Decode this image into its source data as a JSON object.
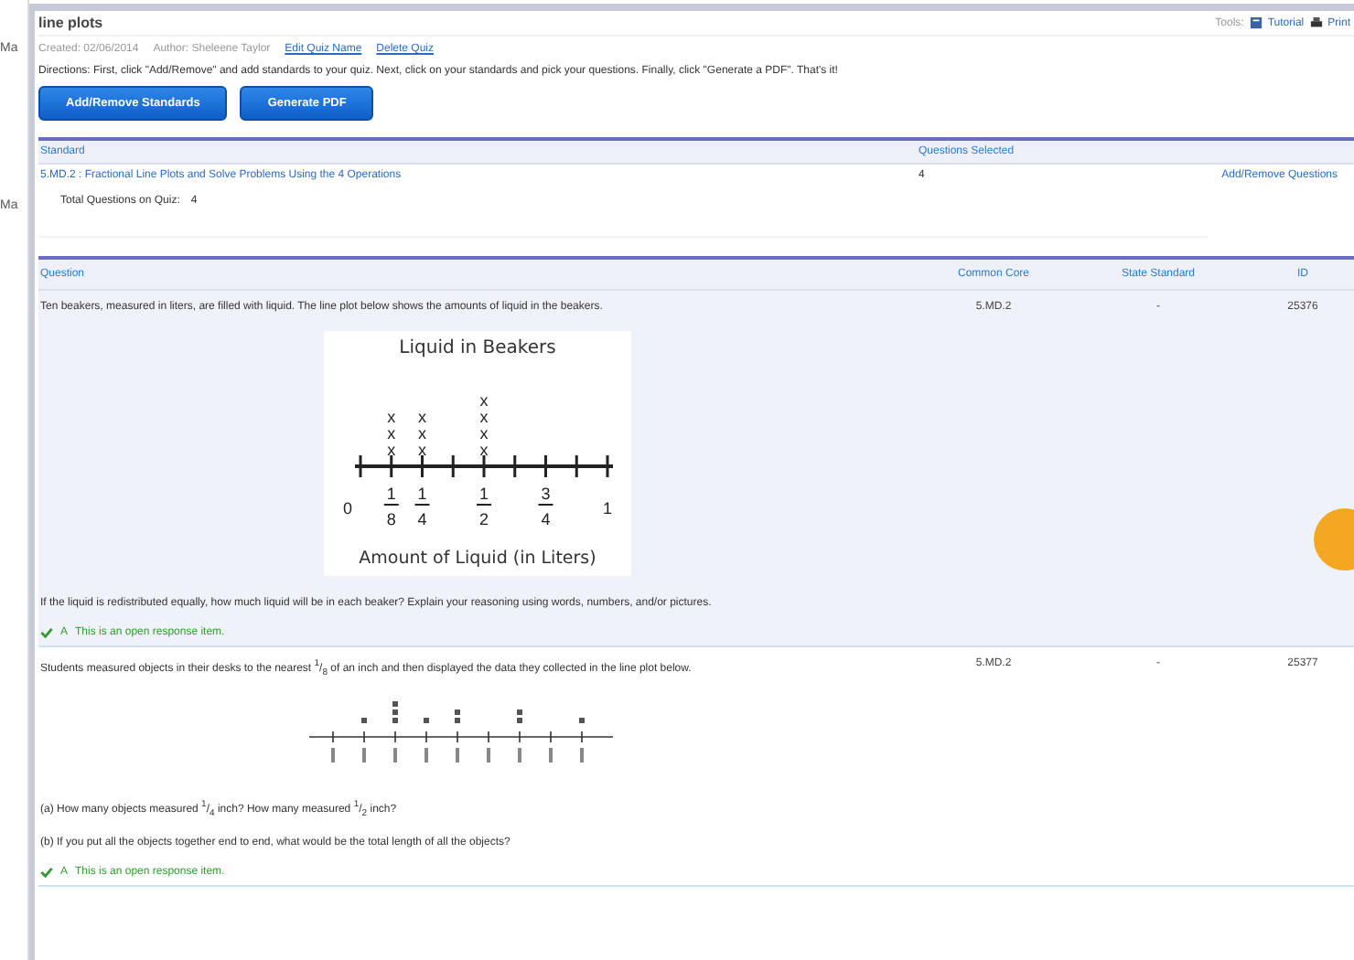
{
  "background": {
    "labels": [
      "Ma",
      "Ma"
    ]
  },
  "quiz": {
    "title": "line plots",
    "created": "Created: 02/06/2014",
    "author": "Author: Sheleene Taylor",
    "links": [
      "Edit Quiz Name",
      "Delete Quiz"
    ],
    "tools": {
      "label": "Tools:",
      "links": [
        "Tutorial",
        "Print"
      ]
    },
    "directions": "Directions: First, click \"Add/Remove\" and add standards to your quiz. Next, click on your standards and pick your questions. Finally, click \"Generate a PDF\". That's it!",
    "buttons": [
      "Add/Remove Standards",
      "Generate PDF"
    ]
  },
  "standards": {
    "columns": [
      "Standard",
      "Questions Selected"
    ],
    "rows": [
      {
        "standard": "5.MD.2 : Fractional Line Plots and Solve Problems Using the 4 Operations",
        "count": "4",
        "action": "Add/Remove Questions"
      }
    ],
    "total_label": "Total Questions on Quiz:",
    "total": "4"
  },
  "questions": {
    "columns": [
      "Question",
      "Common Core",
      "State Standard",
      "ID"
    ],
    "rows": [
      {
        "highlighted": true,
        "prompt": "Ten beakers, measured in liters, are filled with liquid. The line plot below shows the amounts of liquid in the beakers.",
        "common_core": "5.MD.2",
        "state_standard": "-",
        "id": "25376",
        "figure": {
          "kind": "plot",
          "title": "Liquid in Beakers",
          "xlabel": "Amount of Liquid (in Liters)",
          "ticks": [
            {
              "kind": "whole",
              "label": "0"
            },
            {
              "kind": "fraction",
              "numerator": "1",
              "denominator": "8",
              "marks": [
                "x",
                "x",
                "x"
              ]
            },
            {
              "kind": "fraction",
              "numerator": "1",
              "denominator": "4",
              "marks": [
                "x",
                "x",
                "x"
              ]
            },
            {
              "kind": "plain"
            },
            {
              "kind": "fraction",
              "numerator": "1",
              "denominator": "2",
              "marks": [
                "x",
                "x",
                "x",
                "x"
              ]
            },
            {
              "kind": "plain"
            },
            {
              "kind": "fraction",
              "numerator": "3",
              "denominator": "4"
            },
            {
              "kind": "plain"
            },
            {
              "kind": "whole",
              "label": "1"
            }
          ]
        },
        "parts": [
          "If the liquid is redistributed equally, how much liquid will be in each beaker? Explain your reasoning using words, numbers, and/or pictures."
        ],
        "answer": {
          "label": "A",
          "text": "This is an open response item."
        }
      },
      {
        "highlighted": false,
        "prompt": "Students measured objects in their desks to the nearest $^{1}$/$_{8}$ of an inch and then displayed the data they collected in the line plot below.",
        "common_core": "5.MD.2",
        "state_standard": "-",
        "id": "25377",
        "figure": {
          "kind": "drawing"
        },
        "parts": [
          "(a) How many objects measured $^{1}$/$_{4}$ inch? How many measured $^{1}$/$_{2}$ inch?",
          "(b) If you put all the objects together end to end, what would be the total length of all the objects?"
        ],
        "answer": {
          "label": "A",
          "text": "This is an open response item."
        }
      }
    ]
  }
}
